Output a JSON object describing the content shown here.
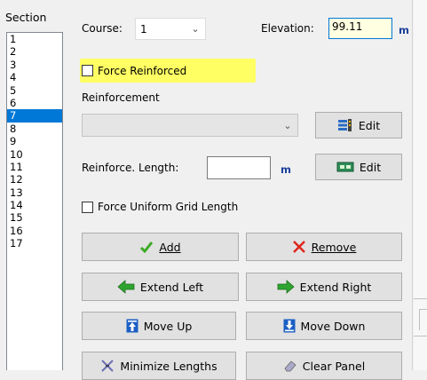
{
  "section_list": {
    "title": "Section",
    "items": [
      "1",
      "2",
      "3",
      "4",
      "5",
      "6",
      "7",
      "8",
      "9",
      "10",
      "11",
      "12",
      "13",
      "14",
      "15",
      "16",
      "17"
    ],
    "selected": "7"
  },
  "course": {
    "label": "Course:",
    "value": "1"
  },
  "elevation": {
    "label": "Elevation:",
    "value": "99.11",
    "unit": "m"
  },
  "force_reinforced": {
    "label": "Force Reinforced",
    "checked": false,
    "highlight_color": "#ffff63"
  },
  "reinforcement": {
    "label": "Reinforcement",
    "value": "",
    "edit_label": "Edit"
  },
  "reinforce_length": {
    "label": "Reinforce. Length:",
    "value": "",
    "unit": "m",
    "edit_label": "Edit"
  },
  "force_uniform": {
    "label": "Force Uniform Grid Length",
    "checked": false
  },
  "buttons": {
    "add": {
      "label": "Add",
      "icon": "green-checkmark-icon"
    },
    "remove": {
      "label": "Remove",
      "icon": "red-x-icon"
    },
    "extend_left": {
      "label": "Extend Left",
      "icon": "green-left-arrow-icon"
    },
    "extend_right": {
      "label": "Extend Right",
      "icon": "green-right-arrow-icon"
    },
    "move_up": {
      "label": "Move Up",
      "icon": "blue-up-arrow-icon"
    },
    "move_down": {
      "label": "Move Down",
      "icon": "blue-down-arrow-icon"
    },
    "minimize_lengths": {
      "label": "Minimize Lengths",
      "icon": "minimize-icon"
    },
    "clear_panel": {
      "label": "Clear Panel",
      "icon": "eraser-icon"
    }
  },
  "colors": {
    "selection": "#0078d7",
    "accent_unit": "#1c3f9c"
  }
}
